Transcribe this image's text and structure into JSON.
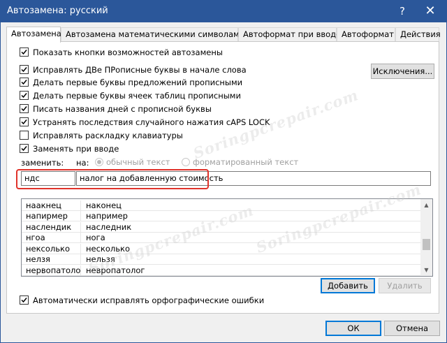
{
  "window": {
    "title": "Автозамена: русский",
    "help": "?",
    "close": "✕"
  },
  "tabs": [
    "Автозамена",
    "Автозамена математическими символами",
    "Автоформат при вводе",
    "Автоформат",
    "Действия"
  ],
  "options": {
    "show_buttons": "Показать кнопки возможностей автозамены",
    "two_caps": "Исправлять ДВе ПРописные буквы в начале слова",
    "sentence_caps": "Делать первые буквы предложений прописными",
    "table_caps": "Делать первые буквы ячеек таблиц прописными",
    "day_names": "Писать названия дней с прописной буквы",
    "caps_lock": "Устранять последствия случайного нажатия cAPS LOCK",
    "keyboard_layout": "Исправлять раскладку клавиатуры",
    "replace_typing": "Заменять при вводе"
  },
  "exceptions_button": "Исключения...",
  "replace": {
    "replace_label": "заменить:",
    "with_label": "на:",
    "plain_text": "обычный текст",
    "formatted_text": "форматированный текст",
    "replace_value": "ндс",
    "with_value": "налог на добавленную стоимость"
  },
  "entries": [
    {
      "from": "наакнец",
      "to": "наконец"
    },
    {
      "from": "напирмер",
      "to": "например"
    },
    {
      "from": "наслендик",
      "to": "наследник"
    },
    {
      "from": "нгоа",
      "to": "нога"
    },
    {
      "from": "нексолько",
      "to": "несколько"
    },
    {
      "from": "нелзя",
      "to": "нельзя"
    },
    {
      "from": "нервопатолог",
      "to": "невропатолог"
    }
  ],
  "add_button": "Добавить",
  "delete_button": "Удалить",
  "spelling_option": "Автоматически исправлять орфографические ошибки",
  "ok_button": "ОК",
  "cancel_button": "Отмена",
  "watermark": "Soringpcrepair.com",
  "colors": {
    "titlebar": "#2b579a",
    "highlight": "#e0322a",
    "accent": "#0078d7"
  }
}
